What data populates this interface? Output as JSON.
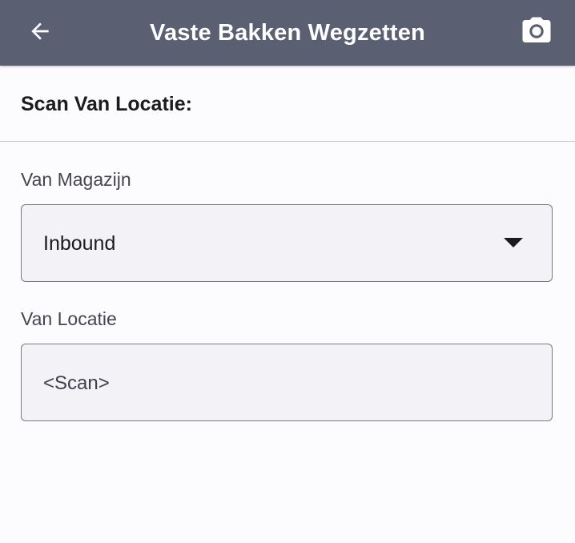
{
  "appbar": {
    "title": "Vaste Bakken Wegzetten",
    "back_icon": "arrow-left-icon",
    "camera_icon": "camera-icon",
    "background": "#5b5f72"
  },
  "section": {
    "title": "Scan Van Locatie:"
  },
  "warehouse_field": {
    "label": "Van Magazijn",
    "selected_value": "Inbound"
  },
  "location_field": {
    "label": "Van Locatie",
    "placeholder": "<Scan>"
  }
}
